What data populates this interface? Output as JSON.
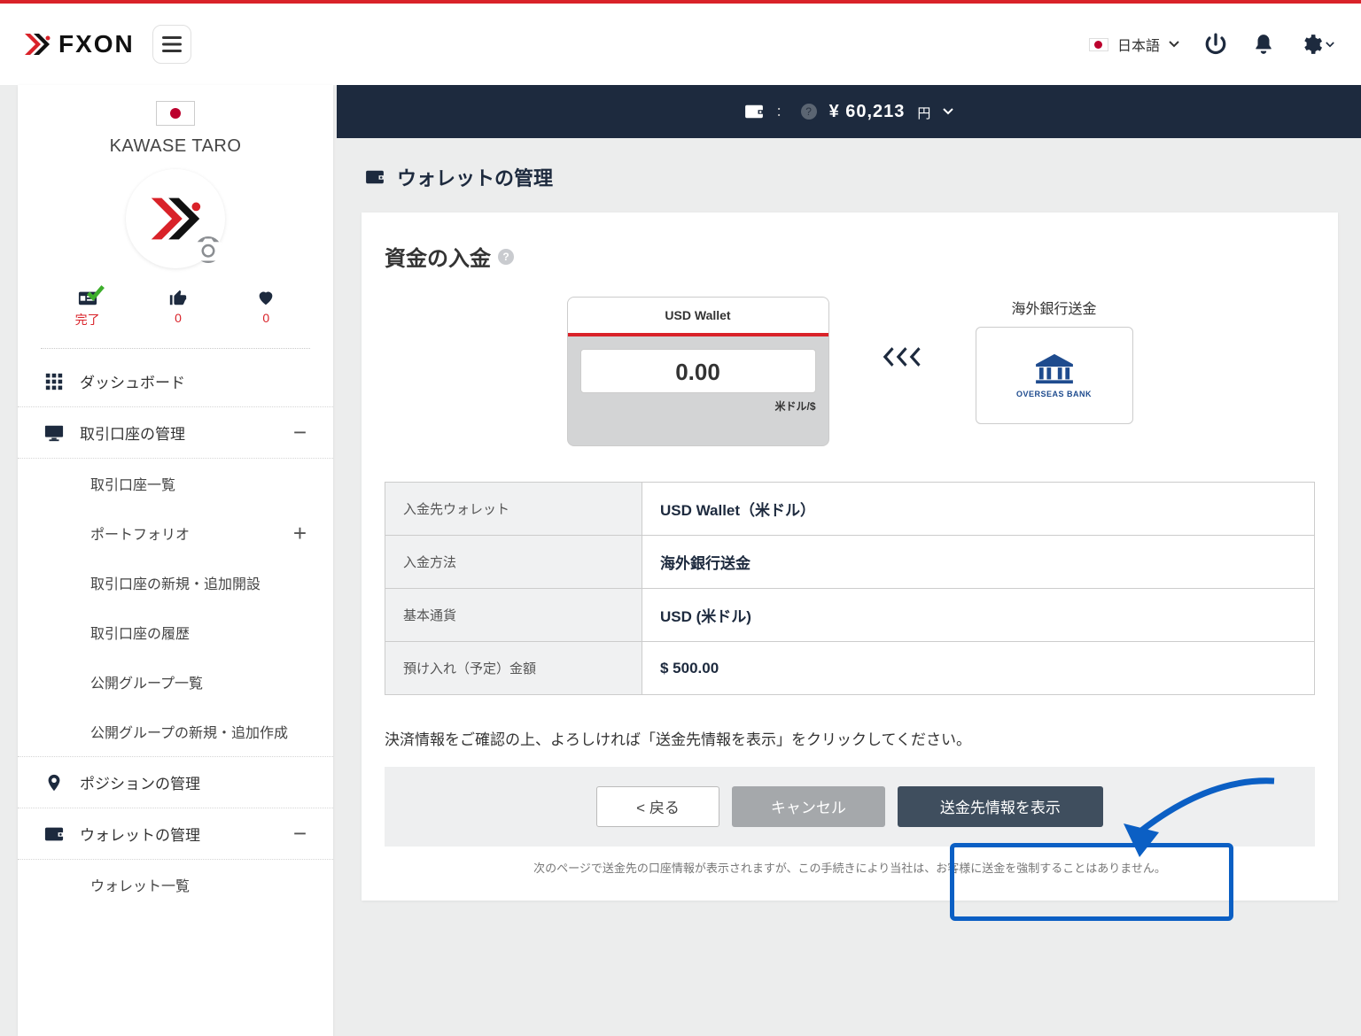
{
  "header": {
    "language": "日本語"
  },
  "user": {
    "name": "KAWASE TARO"
  },
  "metrics": {
    "m1_label": "完了",
    "m2_val": "0",
    "m3_val": "0"
  },
  "sidebar": {
    "dashboard": "ダッシュボード",
    "accounts": "取引口座の管理",
    "sub": {
      "list": "取引口座一覧",
      "portfolio": "ポートフォリオ",
      "newacc": "取引口座の新規・追加開設",
      "history": "取引口座の履歴",
      "groups": "公開グループ一覧",
      "newgroup": "公開グループの新規・追加作成"
    },
    "positions": "ポジションの管理",
    "wallet": "ウォレットの管理",
    "wallet_sub": "ウォレット一覧"
  },
  "balance": {
    "colon": "：",
    "amount": "¥  60,213",
    "unit": "円"
  },
  "page": {
    "title": "ウォレットの管理",
    "section": "資金の入金"
  },
  "wallet": {
    "head": "USD Wallet",
    "value": "0.00",
    "unit": "米ドル/$"
  },
  "bank": {
    "label": "海外銀行送金",
    "text": "OVERSEAS BANK"
  },
  "table": {
    "r1k": "入金先ウォレット",
    "r1v": "USD Wallet（米ドル）",
    "r2k": "入金方法",
    "r2v": "海外銀行送金",
    "r3k": "基本通貨",
    "r3v": "USD (米ドル)",
    "r4k": "預け入れ（予定）金額",
    "r4v": "$ 500.00"
  },
  "note": "決済情報をご確認の上、よろしければ「送金先情報を表示」をクリックしてください。",
  "buttons": {
    "back": "< 戻る",
    "cancel": "キャンセル",
    "primary": "送金先情報を表示"
  },
  "footnote": "次のページで送金先の口座情報が表示されますが、この手続きにより当社は、お客様に送金を強制することはありません。"
}
